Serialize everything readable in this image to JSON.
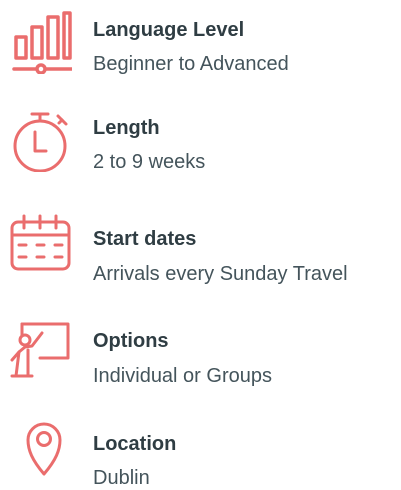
{
  "accent_color": "#ea6d6d",
  "items": [
    {
      "icon": "level-bars-icon",
      "title": "Language Level",
      "description": "Beginner to Advanced"
    },
    {
      "icon": "stopwatch-icon",
      "title": "Length",
      "description": "2 to 9 weeks"
    },
    {
      "icon": "calendar-icon",
      "title": "Start dates",
      "description": "Arrivals every Sunday Travel"
    },
    {
      "icon": "teacher-board-icon",
      "title": "Options",
      "description": "Individual or Groups"
    },
    {
      "icon": "location-pin-icon",
      "title": "Location",
      "description": "Dublin"
    }
  ]
}
